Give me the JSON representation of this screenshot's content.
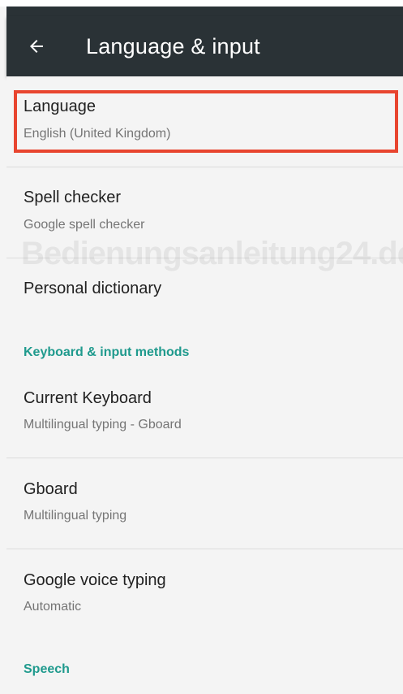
{
  "appbar": {
    "title": "Language & input",
    "back_icon": "arrow-left-icon",
    "background": "#2a3236"
  },
  "settings": {
    "language": {
      "title": "Language",
      "subtitle": "English (United Kingdom)"
    },
    "spell_checker": {
      "title": "Spell checker",
      "subtitle": "Google spell checker"
    },
    "personal_dictionary": {
      "title": "Personal dictionary"
    },
    "keyboard_section": {
      "header": "Keyboard & input methods"
    },
    "current_keyboard": {
      "title": "Current Keyboard",
      "subtitle": "Multilingual typing - Gboard"
    },
    "gboard": {
      "title": "Gboard",
      "subtitle": "Multilingual typing"
    },
    "google_voice_typing": {
      "title": "Google voice typing",
      "subtitle": "Automatic"
    },
    "speech_section": {
      "header": "Speech"
    }
  },
  "watermark": "Bedienungsanleitung24.de",
  "colors": {
    "accent": "#1f9a8d",
    "highlight": "#e8452f"
  }
}
